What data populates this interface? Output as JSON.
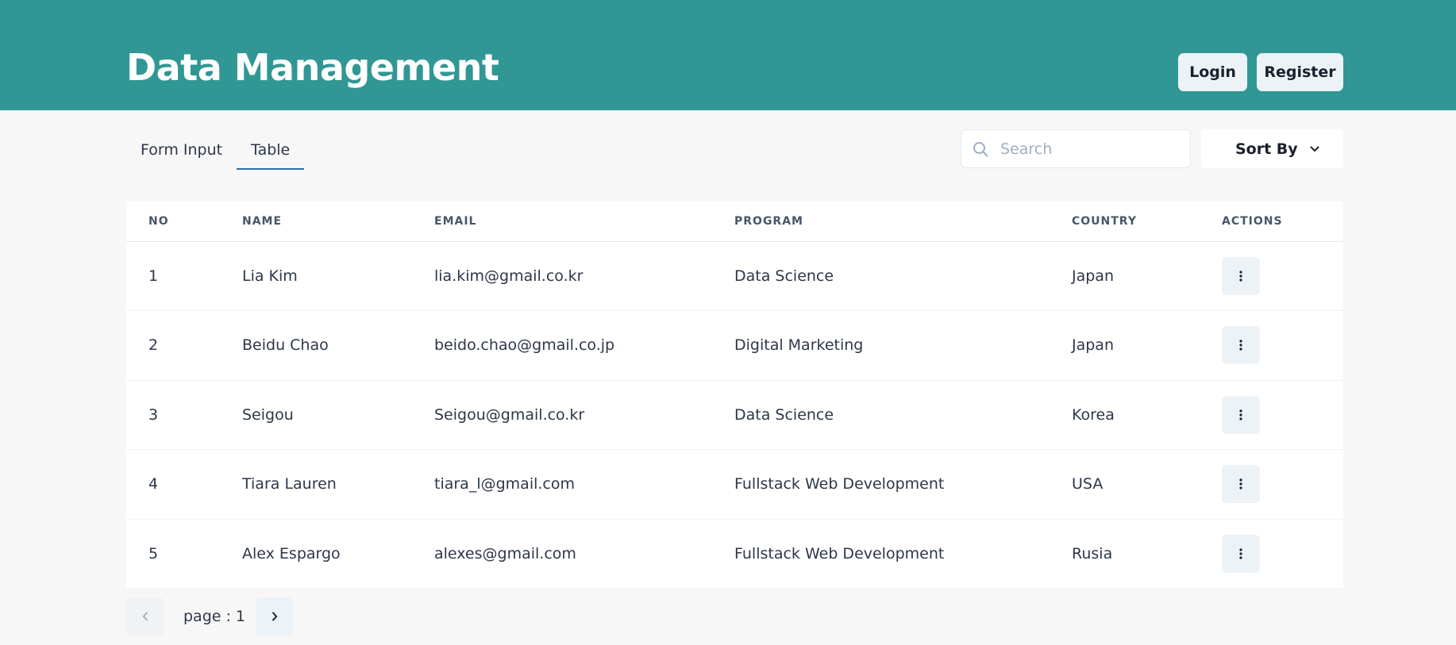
{
  "header": {
    "title": "Data Management",
    "login_label": "Login",
    "register_label": "Register",
    "background_color": "#319795"
  },
  "tabs": [
    {
      "label": "Form Input",
      "active": false
    },
    {
      "label": "Table",
      "active": true
    }
  ],
  "search": {
    "placeholder": "Search",
    "value": "",
    "icon": "search-icon"
  },
  "sort": {
    "label": "Sort By",
    "icon": "chevron-down-icon"
  },
  "table": {
    "columns": [
      "NO",
      "NAME",
      "EMAIL",
      "PROGRAM",
      "COUNTRY",
      "ACTIONS"
    ],
    "rows": [
      {
        "no": "1",
        "name": "Lia Kim",
        "email": "lia.kim@gmail.co.kr",
        "program": "Data Science",
        "country": "Japan"
      },
      {
        "no": "2",
        "name": "Beidu Chao",
        "email": "beido.chao@gmail.co.jp",
        "program": "Digital Marketing",
        "country": "Japan"
      },
      {
        "no": "3",
        "name": "Seigou",
        "email": "Seigou@gmail.co.kr",
        "program": "Data Science",
        "country": "Korea"
      },
      {
        "no": "4",
        "name": "Tiara Lauren",
        "email": "tiara_l@gmail.com",
        "program": "Fullstack Web Development",
        "country": "USA"
      },
      {
        "no": "5",
        "name": "Alex Espargo",
        "email": "alexes@gmail.com",
        "program": "Fullstack Web Development",
        "country": "Rusia"
      }
    ],
    "action_icon": "more-vertical-icon"
  },
  "pagination": {
    "label": "page : 1",
    "prev_icon": "chevron-left-icon",
    "next_icon": "chevron-right-icon"
  }
}
